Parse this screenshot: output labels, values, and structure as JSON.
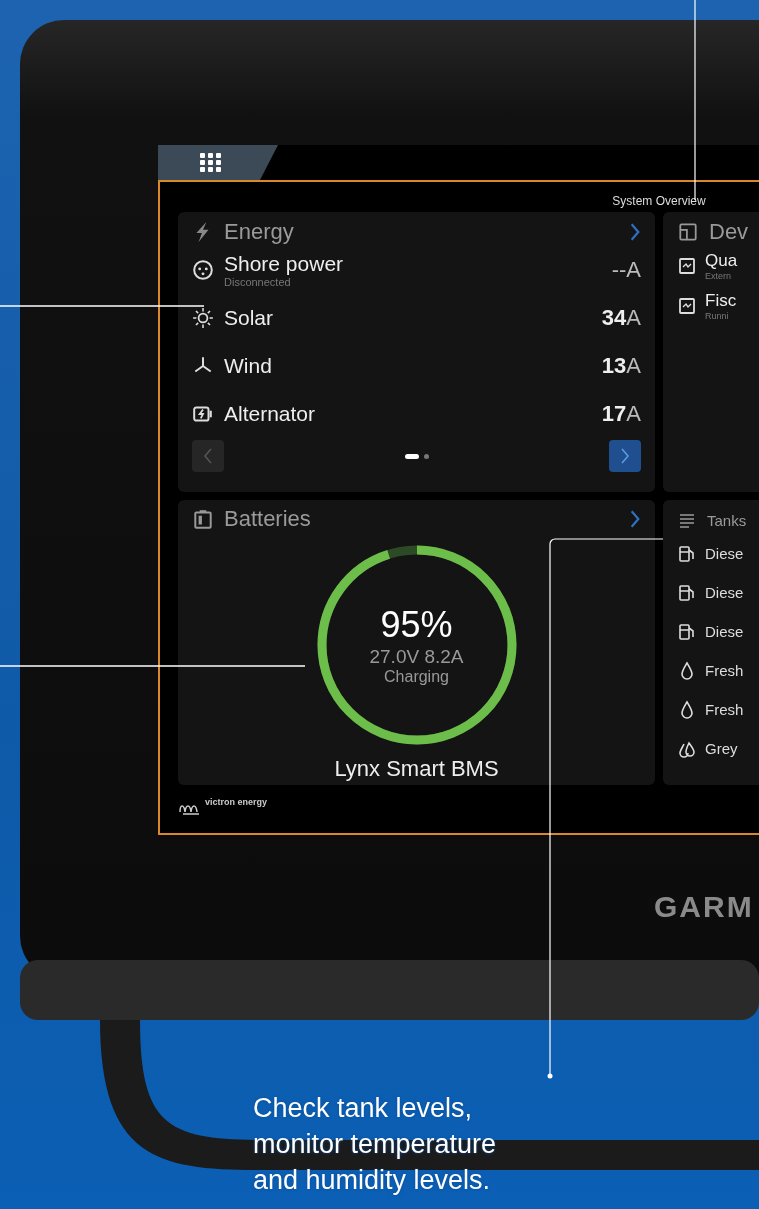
{
  "screen": {
    "title": "System Overview",
    "energy": {
      "title": "Energy",
      "rows": [
        {
          "kind": "shore",
          "label": "Shore power",
          "sub": "Disconnected",
          "value": "--A"
        },
        {
          "kind": "solar",
          "label": "Solar",
          "value": "**34**A"
        },
        {
          "kind": "wind",
          "label": "Wind",
          "value": "**13**A"
        },
        {
          "kind": "alternator",
          "label": "Alternator",
          "value": "**17**A"
        }
      ],
      "prev_disabled": true,
      "next_disabled": false,
      "page_dots": [
        {
          "selected": true
        },
        {
          "selected": false
        }
      ]
    },
    "batteries": {
      "title": "Batteries",
      "percent": "95%",
      "reading": "27.0V 8.2A",
      "status": "Charging",
      "level": 0.95,
      "device": "Lynx Smart BMS"
    },
    "devices": {
      "title": "Dev",
      "rows": [
        {
          "label": "Qua",
          "sub": "Extern"
        },
        {
          "label": "Fisc",
          "sub": "Runni"
        }
      ]
    },
    "tanks": {
      "title": "Tanks",
      "rows": [
        {
          "kind": "fuel",
          "label": "Diese"
        },
        {
          "kind": "fuel",
          "label": "Diese"
        },
        {
          "kind": "fuel",
          "label": "Diese"
        },
        {
          "kind": "water",
          "label": "Fresh"
        },
        {
          "kind": "water",
          "label": "Fresh"
        },
        {
          "kind": "grey",
          "label": "Grey"
        }
      ]
    },
    "logo": "victron energy"
  },
  "brand": "GARM",
  "caption": "Check tank levels,\nmonitor temperature\nand humidity levels."
}
